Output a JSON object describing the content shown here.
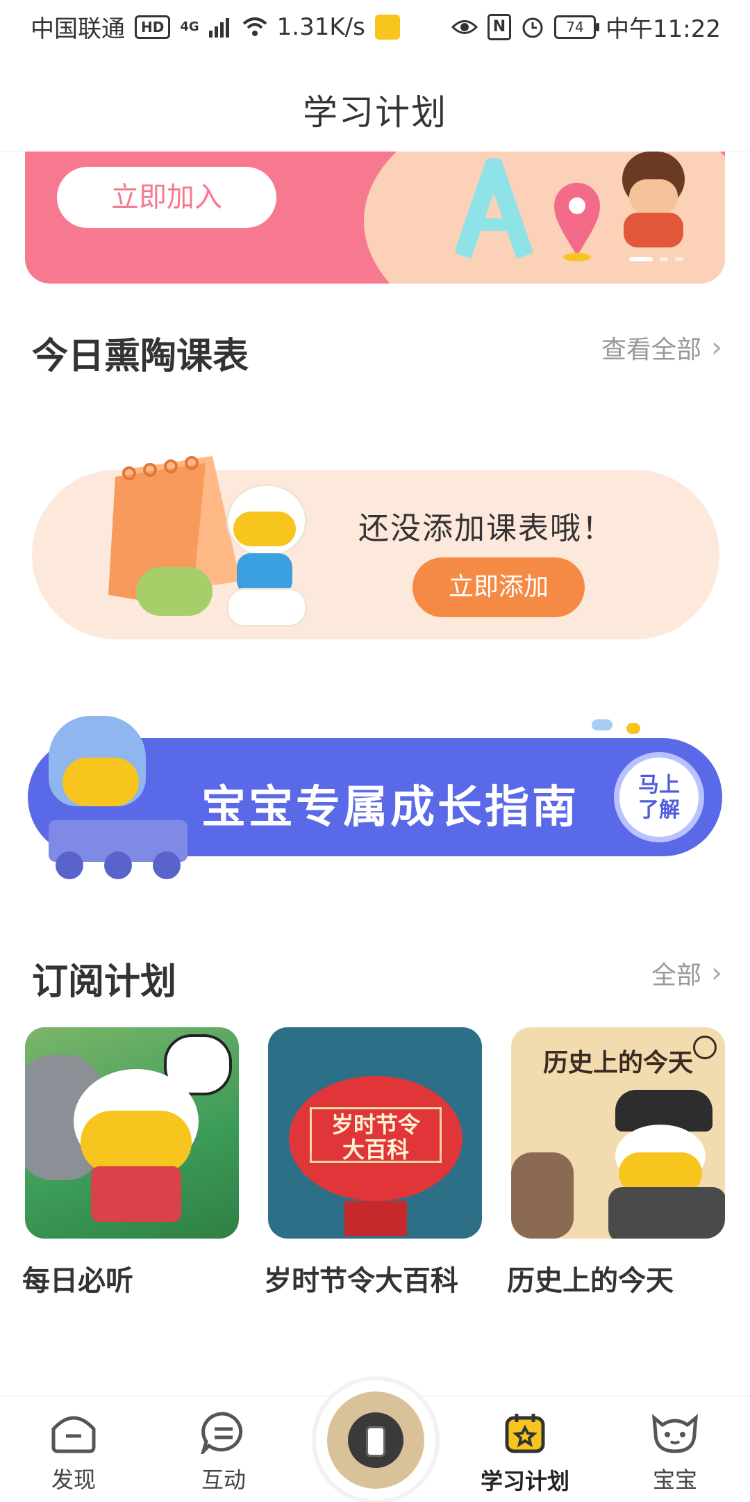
{
  "status_bar": {
    "carrier": "中国联通",
    "hd": "HD",
    "network": "4G",
    "speed": "1.31K/s",
    "battery": "74",
    "time": "中午11:22"
  },
  "header": {
    "title": "学习计划"
  },
  "top_banner": {
    "button_label": "立即加入"
  },
  "today_schedule": {
    "title": "今日熏陶课表",
    "more_label": "查看全部",
    "empty_text": "还没添加课表哦！",
    "add_button": "立即添加"
  },
  "growth_guide": {
    "text": "宝宝专属成长指南",
    "button_line1": "马上",
    "button_line2": "了解"
  },
  "subscriptions": {
    "title": "订阅计划",
    "more_label": "全部",
    "items": [
      {
        "label": "每日必听"
      },
      {
        "label": "岁时节令大百科",
        "image_text_line1": "岁时节令",
        "image_text_line2": "大百科"
      },
      {
        "label": "历史上的今天",
        "image_text": "历史上的今天"
      }
    ]
  },
  "bottom_nav": {
    "items": [
      {
        "label": "发现",
        "icon": "home-icon"
      },
      {
        "label": "互动",
        "icon": "chat-icon"
      },
      {
        "label": "学习计划",
        "icon": "calendar-icon",
        "active": true
      },
      {
        "label": "宝宝",
        "icon": "baby-face-icon"
      }
    ]
  },
  "colors": {
    "pink": "#f6798f",
    "orange": "#f58a45",
    "blue": "#5a69e8",
    "active_nav": "#f7c51e"
  }
}
